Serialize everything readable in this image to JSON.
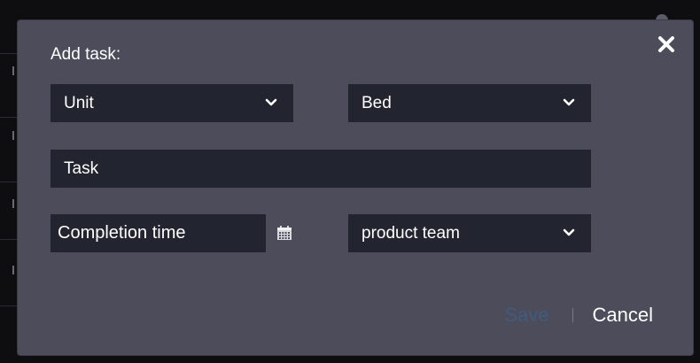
{
  "dialog": {
    "title": "Add task:",
    "close_icon": "close-icon",
    "unit_select": {
      "value": "Unit",
      "icon": "chevron-down-icon"
    },
    "bed_select": {
      "value": "Bed",
      "icon": "chevron-down-icon"
    },
    "task_input": {
      "placeholder": "Task"
    },
    "completion_input": {
      "placeholder": "Completion time",
      "icon": "calendar-icon"
    },
    "team_select": {
      "value": "product team",
      "icon": "chevron-down-icon"
    },
    "save_label": "Save",
    "cancel_label": "Cancel"
  },
  "colors": {
    "modal_bg": "#4d4c5b",
    "field_bg": "#22252f",
    "save_disabled": "#3f5b7e",
    "text": "#ffffff"
  }
}
